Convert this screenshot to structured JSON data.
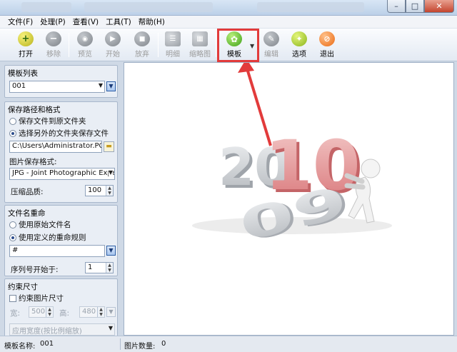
{
  "window": {
    "minimize": "–",
    "maximize": "□",
    "close": "✕"
  },
  "menu": [
    "文件(F)",
    "处理(P)",
    "查看(V)",
    "工具(T)",
    "帮助(H)"
  ],
  "toolbar": {
    "open": "打开",
    "remove": "移除",
    "preview": "预览",
    "start": "开始",
    "discard": "放弃",
    "detail": "明细",
    "thumbnail": "缩略图",
    "template": "模板",
    "edit": "编辑",
    "options": "选项",
    "exit": "退出"
  },
  "panel": {
    "template_list_title": "模板列表",
    "template_value": "001",
    "save_path_title": "保存路径和格式",
    "save_to_original": "保存文件到原文件夹",
    "save_to_other": "选择另外的文件夹保存文件",
    "save_path_value": "C:\\Users\\Administrator.PCOS-16",
    "format_label": "图片保存格式:",
    "format_value": "JPG - Joint Photographic Experts G",
    "quality_label": "压缩品质:",
    "quality_value": "100",
    "rename_title": "文件名重命",
    "use_original_name": "使用原始文件名",
    "use_custom_rule": "使用定义的重命规则",
    "rule_value": "#",
    "seq_label": "序列号开始于:",
    "seq_value": "1",
    "constraint_title": "约束尺寸",
    "constrain_size": "约束图片尺寸",
    "width_label": "宽:",
    "width_value": "500",
    "height_label": "高:",
    "height_value": "480",
    "scale_mode": "应用宽度(按比例缩放)"
  },
  "preview": {
    "text_top": "2010",
    "text_bottom": "09"
  },
  "statusbar": {
    "template_label": "模板名称:",
    "template_value": "001",
    "count_label": "图片数量:",
    "count_value": "0"
  },
  "colors": {
    "highlight": "#e23b3b",
    "accent_blue": "#2e5fa6"
  }
}
